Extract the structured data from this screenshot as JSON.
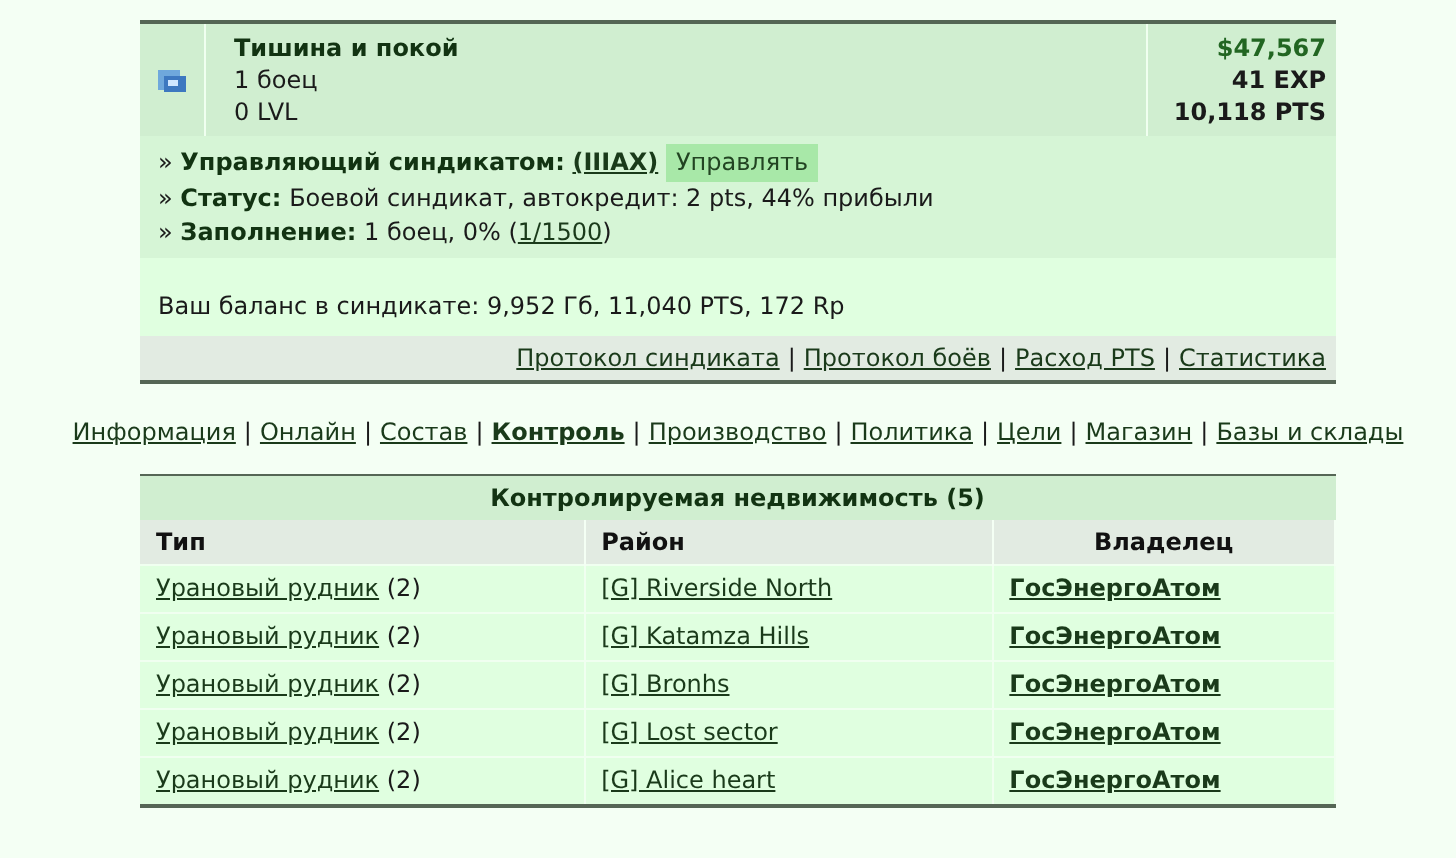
{
  "syndicate": {
    "name": "Тишина и покой",
    "members": "1 боец",
    "level": "0 LVL",
    "money": "$47,567",
    "exp": "41 EXP",
    "pts": "10,118 PTS"
  },
  "info": [
    {
      "label": "Управляющий синдикатом:",
      "kind": "manager",
      "link": "(IIIAX)",
      "button": "Управлять"
    },
    {
      "label": "Статус:",
      "kind": "text",
      "text": "Боевой синдикат, автокредит: 2 pts, 44% прибыли"
    },
    {
      "label": "Заполнение:",
      "kind": "fill",
      "text": "1 боец, 0% (",
      "link": "1/1500",
      "after": ")"
    }
  ],
  "balance": "Ваш баланс в синдикате: 9,952 Гб, 11,040 PTS, 172 Rp",
  "bullet": "»",
  "separator": "|",
  "sub_links": [
    "Протокол синдиката",
    "Протокол боёв",
    "Расход PTS",
    "Статистика"
  ],
  "nav": [
    {
      "label": "Информация",
      "selected": false
    },
    {
      "label": "Онлайн",
      "selected": false
    },
    {
      "label": "Состав",
      "selected": false
    },
    {
      "label": "Контроль",
      "selected": true
    },
    {
      "label": "Производство",
      "selected": false
    },
    {
      "label": "Политика",
      "selected": false
    },
    {
      "label": "Цели",
      "selected": false
    },
    {
      "label": "Магазин",
      "selected": false
    },
    {
      "label": "Базы и склады",
      "selected": false
    }
  ],
  "table": {
    "title": "Контролируемая недвижимость (5)",
    "columns": [
      "Тип",
      "Район",
      "Владелец"
    ],
    "rows": [
      {
        "type": "Урановый рудник",
        "count": "(2)",
        "district": "[G] Riverside North",
        "owner": "ГосЭнергоАтом"
      },
      {
        "type": "Урановый рудник",
        "count": "(2)",
        "district": "[G] Katamza Hills",
        "owner": "ГосЭнергоАтом"
      },
      {
        "type": "Урановый рудник",
        "count": "(2)",
        "district": "[G] Bronhs",
        "owner": "ГосЭнергоАтом"
      },
      {
        "type": "Урановый рудник",
        "count": "(2)",
        "district": "[G] Lost sector",
        "owner": "ГосЭнергоАтом"
      },
      {
        "type": "Урановый рудник",
        "count": "(2)",
        "district": "[G] Alice heart",
        "owner": "ГосЭнергоАтом"
      }
    ]
  }
}
